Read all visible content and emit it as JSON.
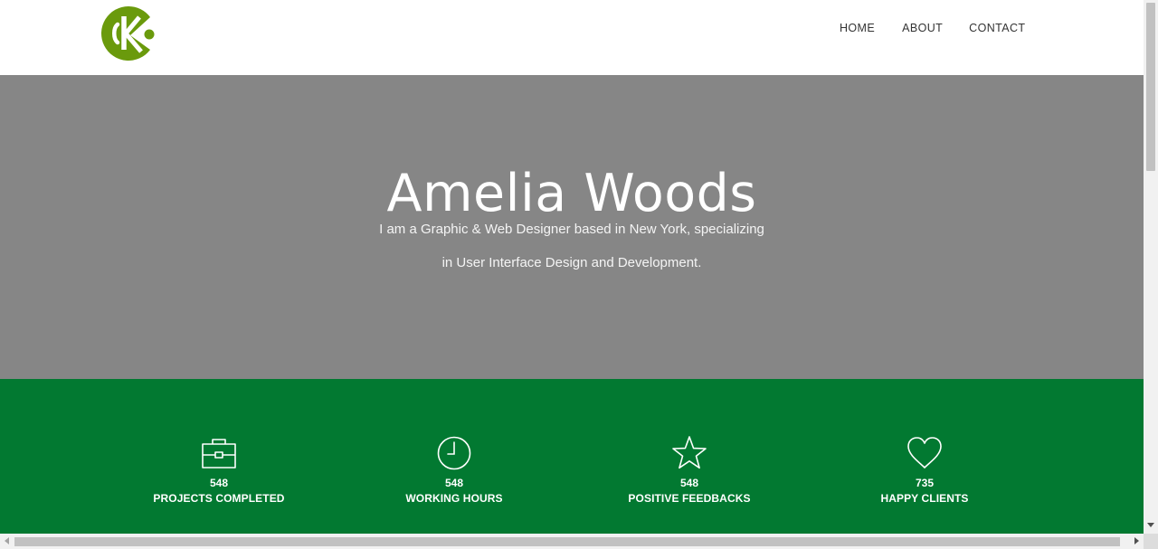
{
  "header": {
    "logo_icon": "ck-logo-icon",
    "nav": {
      "home": "HOME",
      "about": "ABOUT",
      "contact": "CONTACT"
    }
  },
  "hero": {
    "title": "Amelia Woods",
    "subtitle_line1": "I am a Graphic & Web Designer based in New York, specializing",
    "subtitle_line2": "in User Interface Design and Development."
  },
  "stats": [
    {
      "icon": "briefcase-icon",
      "value": "548",
      "label": "PROJECTS COMPLETED"
    },
    {
      "icon": "clock-icon",
      "value": "548",
      "label": "WORKING HOURS"
    },
    {
      "icon": "star-icon",
      "value": "548",
      "label": "POSITIVE FEEDBACKS"
    },
    {
      "icon": "heart-icon",
      "value": "735",
      "label": "HAPPY CLIENTS"
    }
  ],
  "colors": {
    "logo_green": "#6a9a0c",
    "hero_bg": "#868686",
    "stats_bg": "#027931",
    "text_white": "#ffffff"
  }
}
